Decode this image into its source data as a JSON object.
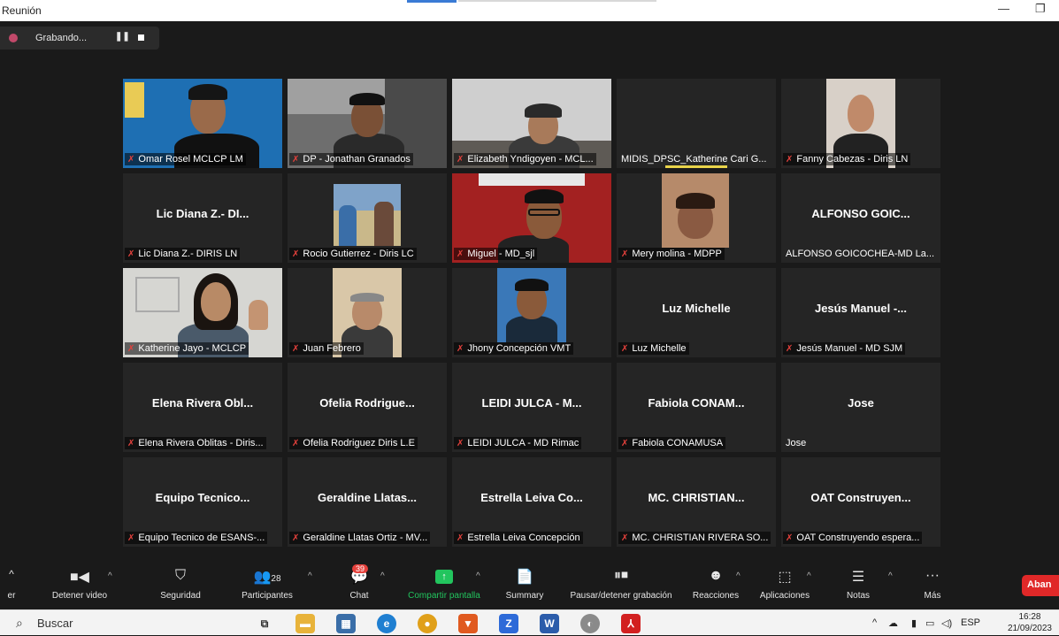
{
  "window": {
    "title": "Reunión"
  },
  "recording": {
    "label": "Grabando...",
    "pause_glyph": "❚❚"
  },
  "tiles": [
    {
      "display": "video",
      "name": "Omar Rosel MCLCP LM",
      "muted": true
    },
    {
      "display": "video",
      "name": "DP - Jonathan Granados",
      "muted": true
    },
    {
      "display": "video",
      "name": "Elizabeth Yndigoyen - MCL...",
      "muted": true
    },
    {
      "display": "empty",
      "name": "MIDIS_DPSC_Katherine Cari G...",
      "muted": false
    },
    {
      "display": "video",
      "name": "Fanny Cabezas - Diris LN",
      "muted": true
    },
    {
      "display": "text",
      "big": "Lic Diana Z.- DI...",
      "name": "Lic Diana Z.- DIRIS LN",
      "muted": true
    },
    {
      "display": "video",
      "name": "Rocio Gutierrez - Diris LC",
      "muted": true
    },
    {
      "display": "video",
      "name": "Miguel - MD_sjl",
      "muted": true
    },
    {
      "display": "video",
      "name": "Mery molina - MDPP",
      "muted": true
    },
    {
      "display": "text",
      "big": "ALFONSO GOIC...",
      "name": "ALFONSO GOICOCHEA-MD La...",
      "muted": false
    },
    {
      "display": "video",
      "name": "Katherine Jayo - MCLCP",
      "muted": true
    },
    {
      "display": "video",
      "name": "Juan Febrero",
      "muted": true
    },
    {
      "display": "video",
      "name": "Jhony Concepción VMT",
      "muted": true
    },
    {
      "display": "text",
      "big": "Luz Michelle",
      "name": "Luz Michelle",
      "muted": true
    },
    {
      "display": "text",
      "big": "Jesús Manuel -...",
      "name": "Jesús Manuel - MD SJM",
      "muted": true
    },
    {
      "display": "text",
      "big": "Elena Rivera Obl...",
      "name": "Elena Rivera Oblitas - Diris...",
      "muted": true
    },
    {
      "display": "text",
      "big": "Ofelia Rodrigue...",
      "name": "Ofelia Rodriguez Diris L.E",
      "muted": true
    },
    {
      "display": "text",
      "big": "LEIDI JULCA - M...",
      "name": "LEIDI JULCA - MD Rimac",
      "muted": true
    },
    {
      "display": "text",
      "big": "Fabiola CONAM...",
      "name": "Fabiola CONAMUSA",
      "muted": true
    },
    {
      "display": "text",
      "big": "Jose",
      "name": "Jose",
      "muted": false
    },
    {
      "display": "text",
      "big": "Equipo Tecnico...",
      "name": "Equipo Tecnico de ESANS-...",
      "muted": true
    },
    {
      "display": "text",
      "big": "Geraldine Llatas...",
      "name": "Geraldine Llatas Ortiz - MV...",
      "muted": true
    },
    {
      "display": "text",
      "big": "Estrella Leiva Co...",
      "name": "Estrella Leiva Concepción",
      "muted": true
    },
    {
      "display": "text",
      "big": "MC. CHRISTIAN...",
      "name": "MC. CHRISTIAN RIVERA SO...",
      "muted": true
    },
    {
      "display": "text",
      "big": "OAT Construyen...",
      "name": "OAT Construyendo espera...",
      "muted": true
    }
  ],
  "toolbar": {
    "buttons": [
      {
        "label": "er",
        "icon": "microphone-icon"
      },
      {
        "label": "Detener video",
        "icon": "video-camera-icon"
      },
      {
        "label": "Seguridad",
        "icon": "shield-icon"
      },
      {
        "label": "Participantes",
        "icon": "participants-icon",
        "count": "28"
      },
      {
        "label": "Chat",
        "icon": "chat-icon",
        "badge": "39"
      },
      {
        "label": "Compartir pantalla",
        "icon": "share-screen-icon"
      },
      {
        "label": "Summary",
        "icon": "summary-icon"
      },
      {
        "label": "Pausar/detener grabación",
        "icon": "pause-stop-recording-icon"
      },
      {
        "label": "Reacciones",
        "icon": "reactions-icon"
      },
      {
        "label": "Aplicaciones",
        "icon": "apps-icon"
      },
      {
        "label": "Notas",
        "icon": "notes-icon"
      },
      {
        "label": "Más",
        "icon": "more-icon"
      }
    ],
    "end_label": "Aban",
    "share_color": "#22c55e"
  },
  "taskbar": {
    "search_placeholder": "Buscar",
    "lang": "ESP",
    "time": "16:28",
    "date": "21/09/2023"
  }
}
